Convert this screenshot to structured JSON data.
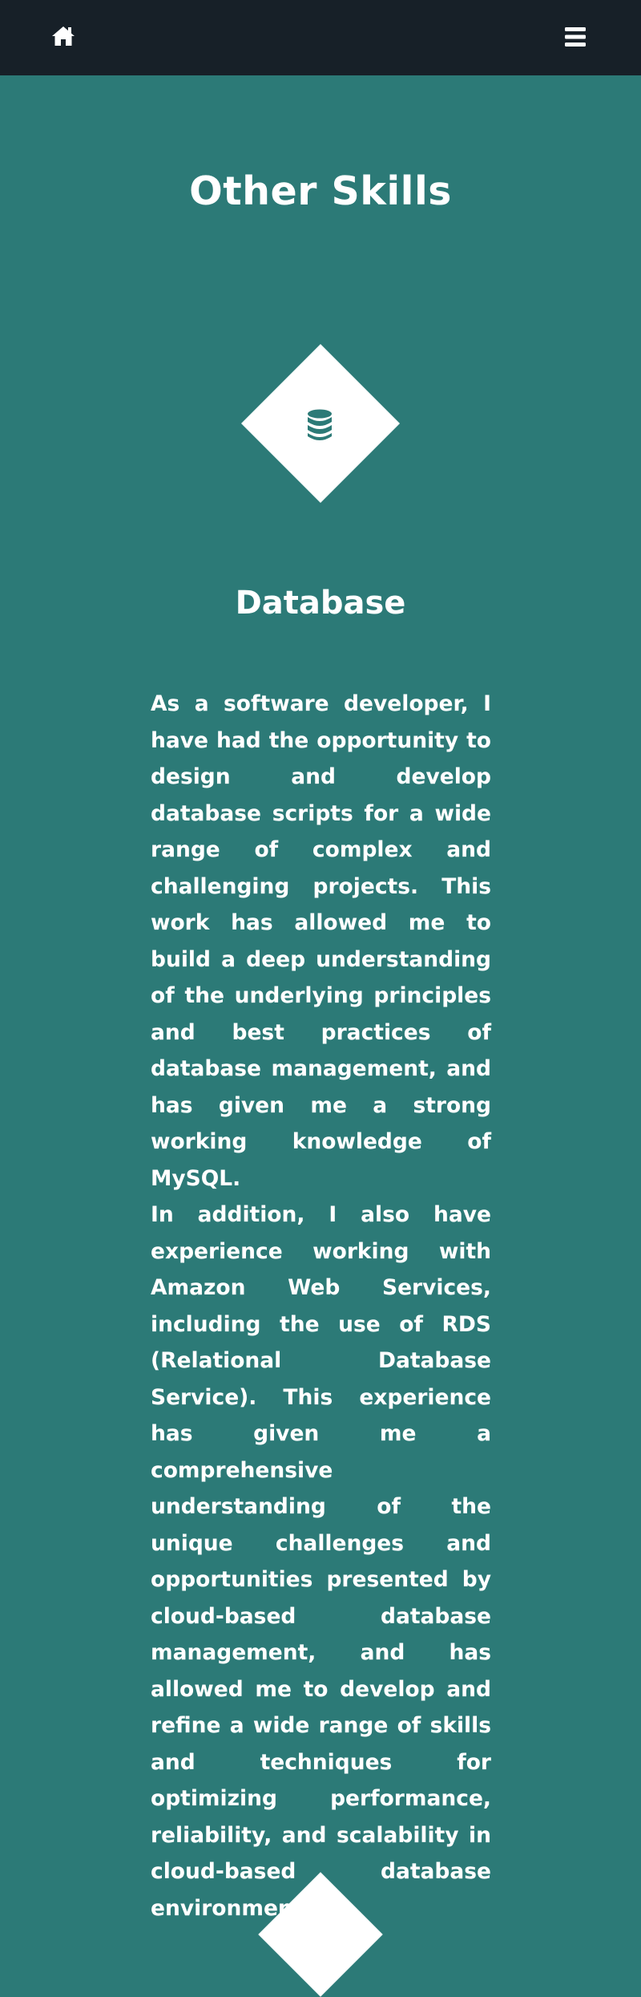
{
  "nav": {
    "home_icon": "home-icon",
    "menu_icon": "hamburger-menu-icon"
  },
  "section": {
    "title": "Other Skills"
  },
  "skills": [
    {
      "icon": "database-icon",
      "title": "Database",
      "paragraphs": [
        "As a software developer, I have had the opportunity to design and develop database scripts for a wide range of complex and challenging projects. This work has allowed me to build a deep understanding of the underlying principles and best practices of database management, and has given me a strong working knowledge of MySQL.",
        "In addition, I also have experience working with Amazon Web Services, including the use of RDS (Relational Database Service). This experience has given me a comprehensive understanding of the unique challenges and opportunities presented by cloud-based database management, and has allowed me to develop and refine a wide range of skills and techniques for optimizing performance, reliability, and scalability in cloud-based database environments."
      ]
    }
  ],
  "colors": {
    "background": "#2c7a77",
    "topbar": "#172028",
    "text": "#ffffff"
  }
}
